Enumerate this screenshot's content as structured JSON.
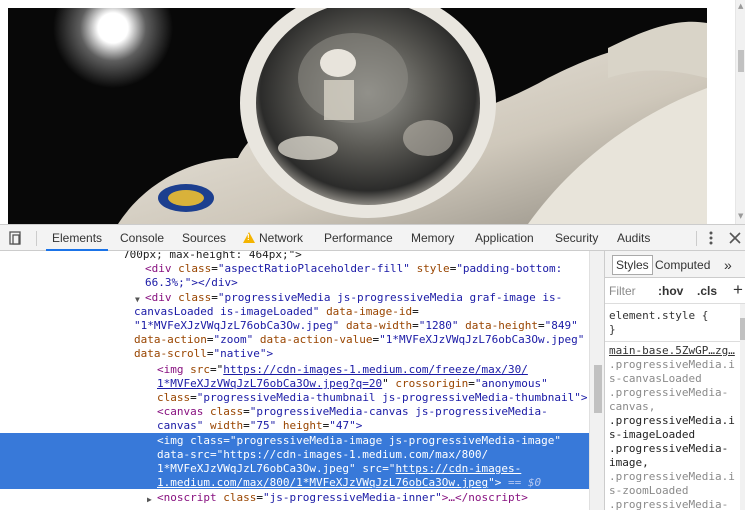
{
  "devtools": {
    "tabs": [
      "Elements",
      "Console",
      "Sources",
      "Network",
      "Performance",
      "Memory",
      "Application",
      "Security",
      "Audits"
    ],
    "active_tab": "Elements",
    "network_warning": true
  },
  "elements": {
    "lines": {
      "l0": "700px; max-height: 464px;\">",
      "l1_tag": "<div",
      "l1_attr": "class",
      "l1_val": "\"aspectRatioPlaceholder-fill\"",
      "l1_attr2": "style",
      "l1_val2": "\"padding-bottom:",
      "l2": "66.3%;\"></div>",
      "l3_tag": "<div",
      "l3_attr": "class",
      "l3_val": "\"progressiveMedia js-progressiveMedia graf-image is-",
      "l4_val": "canvasLoaded is-imageLoaded\"",
      "l4_attr": "data-image-id",
      "l4_eq": "=",
      "l5_val": "\"1*MVFeXJzVWqJzL76obCa3Ow.jpeg\"",
      "l5_attr": "data-width",
      "l5_val2": "\"1280\"",
      "l5_attr2": "data-height",
      "l5_val3": "\"849\"",
      "l6_attr": "data-action",
      "l6_val": "\"zoom\"",
      "l6_attr2": "data-action-value",
      "l6_val2": "\"1*MVFeXJzVWqJzL76obCa3Ow.jpeg\"",
      "l7_attr": "data-scroll",
      "l7_val": "\"native\">",
      "l8_tag": "<img",
      "l8_attr": "src",
      "l8_link": "https://cdn-images-1.medium.com/freeze/max/30/",
      "l9_link": "1*MVFeXJzVWqJzL76obCa3Ow.jpeg?q=20",
      "l9_attr": "crossorigin",
      "l9_val": "\"anonymous\"",
      "l10_attr": "class",
      "l10_val": "\"progressiveMedia-thumbnail js-progressiveMedia-thumbnail\">",
      "l11_tag": "<canvas",
      "l11_attr": "class",
      "l11_val": "\"progressiveMedia-canvas js-progressiveMedia-",
      "l12_val": "canvas\"",
      "l12_attr": "width",
      "l12_val2": "\"75\"",
      "l12_attr2": "height",
      "l12_val3": "\"47\">",
      "s0_tag": "<img",
      "s0_attr": "class",
      "s0_val": "\"progressiveMedia-image js-progressiveMedia-image\"",
      "s1_attr": "data-src",
      "s1_val": "\"https://cdn-images-1.medium.com/max/800/",
      "s2_val": "1*MVFeXJzVWqJzL76obCa3Ow.jpeg\"",
      "s2_attr": "src",
      "s2_link": "https://cdn-images-",
      "s3_link": "1.medium.com/max/800/1*MVFeXJzVWqJzL76obCa3Ow.jpeg",
      "s3_end": "\">",
      "s3_dollar": "== $0",
      "l13_tag": "<noscript",
      "l13_attr": "class",
      "l13_val": "\"js-progressiveMedia-inner\"",
      "l13_end": ">…</noscript>"
    }
  },
  "styles_pane": {
    "tabs": [
      "Styles",
      "Computed"
    ],
    "more": "»",
    "filter_placeholder": "Filter",
    "hov": ":hov",
    ".cls": ".cls",
    "add": "+",
    "rules": [
      "element.style {",
      "}",
      "main-base.5ZwGP…zg…",
      ".progressiveMedia.i",
      "s-canvasLoaded",
      ".progressiveMedia-",
      "canvas,",
      ".progressiveMedia.i",
      "s-imageLoaded",
      ".progressiveMedia-",
      "image,",
      ".progressiveMedia.i",
      "s-zoomLoaded",
      ".progressiveMedia-"
    ]
  },
  "colors": {
    "selection": "#3879d9",
    "tag": "#881280",
    "attr": "#994500",
    "value": "#1a1aa6",
    "active_tab_underline": "#1a73e8"
  }
}
